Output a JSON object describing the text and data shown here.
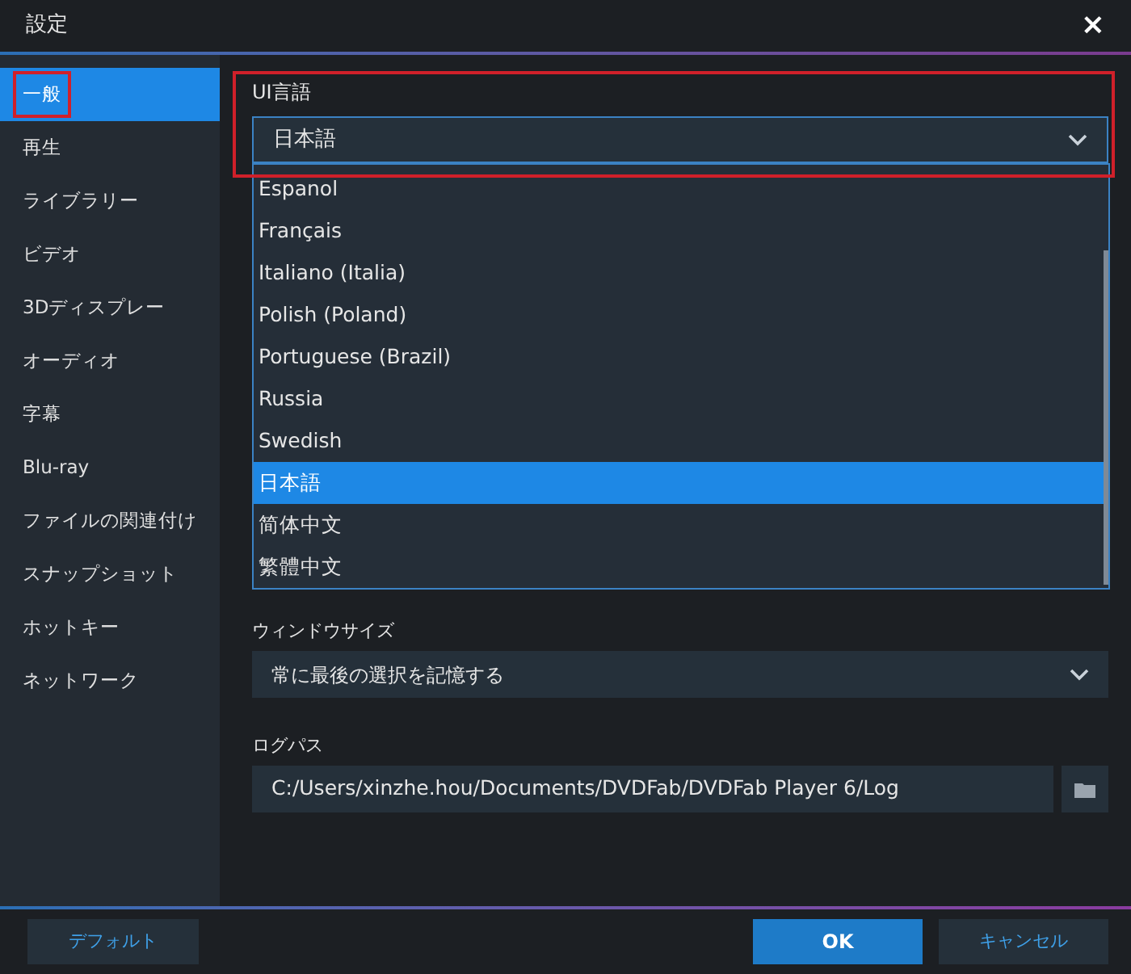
{
  "window": {
    "title": "設定",
    "close": "×"
  },
  "sidebar": {
    "items": [
      {
        "label": "一般",
        "selected": true
      },
      {
        "label": "再生",
        "selected": false
      },
      {
        "label": "ライブラリー",
        "selected": false
      },
      {
        "label": "ビデオ",
        "selected": false
      },
      {
        "label": "3Dディスプレー",
        "selected": false
      },
      {
        "label": "オーディオ",
        "selected": false
      },
      {
        "label": "字幕",
        "selected": false
      },
      {
        "label": "Blu-ray",
        "selected": false
      },
      {
        "label": "ファイルの関連付け",
        "selected": false
      },
      {
        "label": "スナップショット",
        "selected": false
      },
      {
        "label": "ホットキー",
        "selected": false
      },
      {
        "label": "ネットワーク",
        "selected": false
      }
    ]
  },
  "ui_language": {
    "label": "UI言語",
    "value": "日本語",
    "expanded": true,
    "options": [
      {
        "label": "Espanol",
        "selected": false
      },
      {
        "label": "Français",
        "selected": false
      },
      {
        "label": "Italiano (Italia)",
        "selected": false
      },
      {
        "label": "Polish (Poland)",
        "selected": false
      },
      {
        "label": "Portuguese (Brazil)",
        "selected": false
      },
      {
        "label": "Russia",
        "selected": false
      },
      {
        "label": "Swedish",
        "selected": false
      },
      {
        "label": "日本語",
        "selected": true
      },
      {
        "label": "简体中文",
        "selected": false
      },
      {
        "label": "繁體中文",
        "selected": false
      }
    ]
  },
  "window_size": {
    "label": "ウィンドウサイズ",
    "value": "常に最後の選択を記憶する"
  },
  "log_path": {
    "label": "ログパス",
    "value": "C:/Users/xinzhe.hou/Documents/DVDFab/DVDFab Player 6/Log"
  },
  "buttons": {
    "default": "デフォルト",
    "ok": "OK",
    "cancel": "キャンセル"
  }
}
